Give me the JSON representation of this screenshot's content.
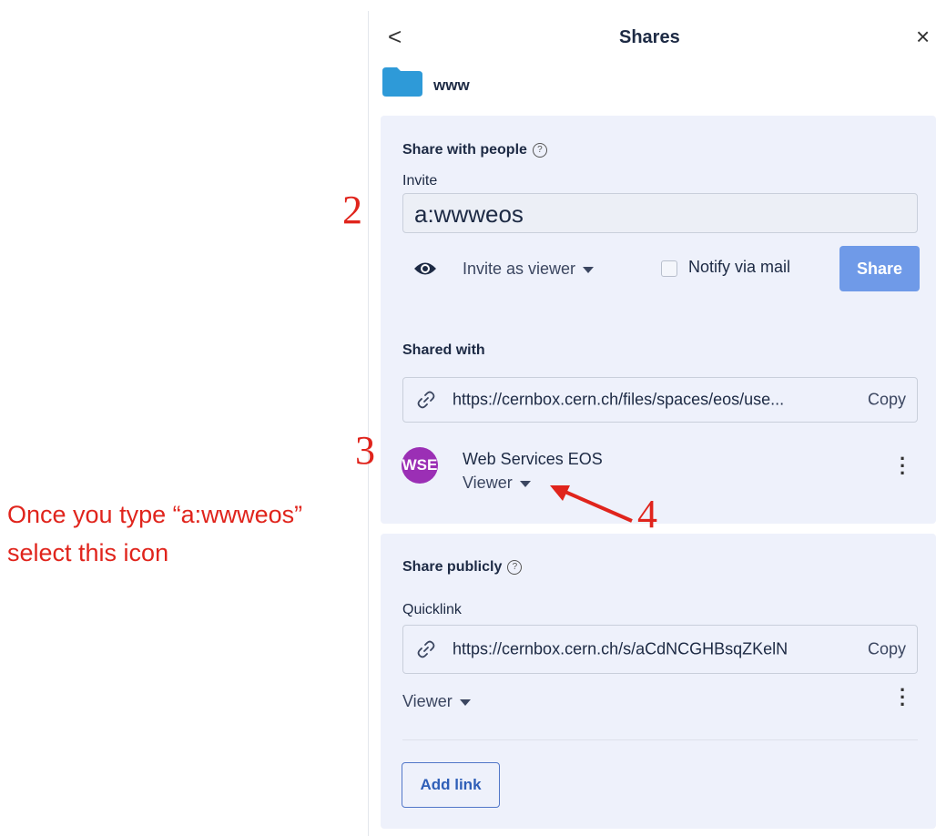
{
  "header": {
    "back": "<",
    "title": "Shares",
    "close": "×"
  },
  "folder": {
    "name": "www",
    "color": "#2e9ad8"
  },
  "share_with_people": {
    "heading": "Share with people",
    "help": "?",
    "invite_label": "Invite",
    "invite_value": "a:wwweos",
    "role_dropdown": "Invite as viewer",
    "notify_label": "Notify via mail",
    "share_button": "Share"
  },
  "shared_with": {
    "heading": "Shared with",
    "link_url": "https://cernbox.cern.ch/files/spaces/eos/use...",
    "copy_label": "Copy",
    "person": {
      "initials": "WSE",
      "name": "Web Services EOS",
      "role": "Viewer",
      "avatar_color": "#9b2fb5"
    }
  },
  "share_publicly": {
    "heading": "Share publicly",
    "help": "?",
    "quicklink_label": "Quicklink",
    "link_url": "https://cernbox.cern.ch/s/aCdNCGHBsqZKelN",
    "copy_label": "Copy",
    "role": "Viewer",
    "add_link": "Add link"
  },
  "annotations": {
    "step2": "2",
    "step3": "3",
    "step4": "4",
    "instruction_line1": "Once you type “a:wwweos”",
    "instruction_line2": "select this icon",
    "color": "#e0241c"
  },
  "colors": {
    "accent": "#6f9ae8",
    "panel": "#eef1fb",
    "avatar": "#9b2fb5"
  }
}
